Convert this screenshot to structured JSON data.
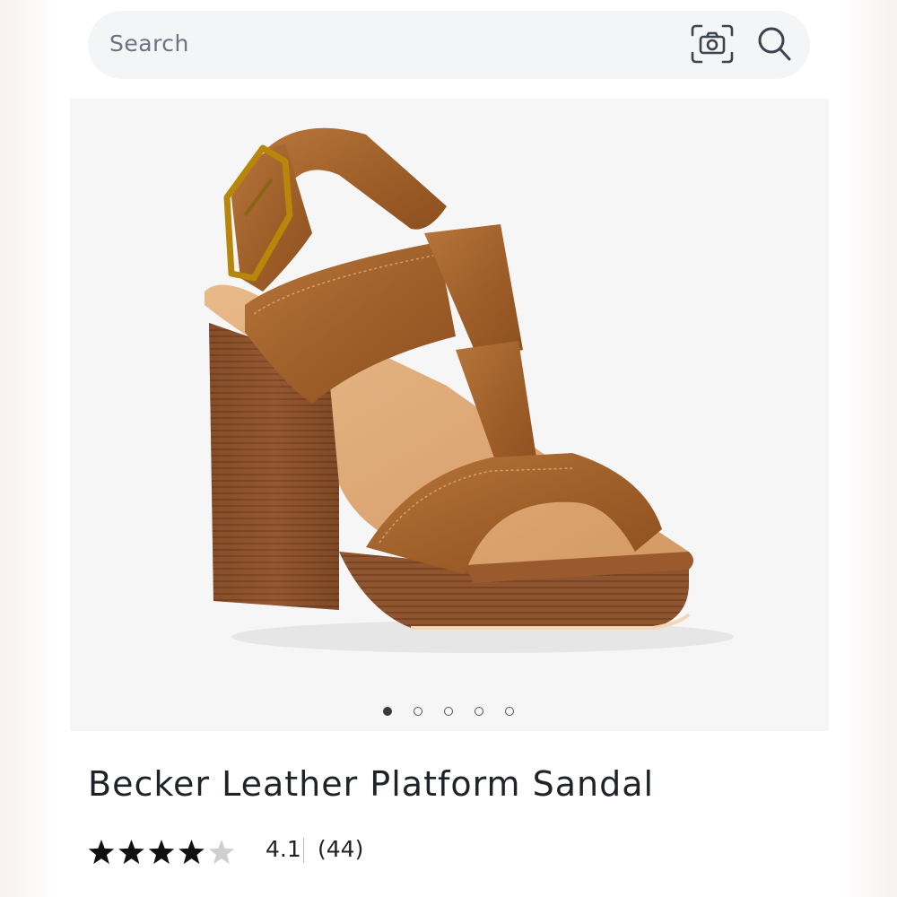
{
  "search": {
    "placeholder": "Search",
    "camera_icon": "camera-scan-icon",
    "search_icon": "search-icon"
  },
  "carousel": {
    "dot_count": 5,
    "active_index": 0
  },
  "product": {
    "title": "Becker Leather Platform Sandal",
    "image_alt": "leather-platform-sandal-image",
    "rating": {
      "value": "4.1",
      "count": "(44)",
      "stars_filled": 4,
      "stars_total": 5
    }
  },
  "colors": {
    "leather": "#a0602a",
    "heel_wood": "#8a5530",
    "buckle_gold": "#b8860b",
    "star_filled": "#111111",
    "star_empty": "#cfcfcf",
    "text_primary": "#1f2328",
    "search_bg": "#f4f5f6"
  }
}
